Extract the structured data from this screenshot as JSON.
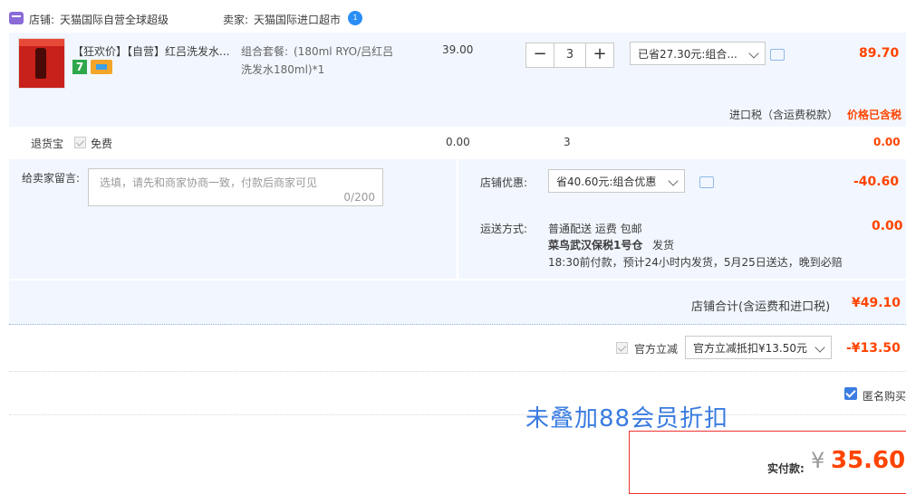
{
  "shop": {
    "label_shop": "店铺:",
    "shop_name": "天猫国际自营全球超级",
    "label_seller": "卖家:",
    "seller_name": "天猫国际进口超市",
    "badge_text": "1"
  },
  "item": {
    "title": "【狂欢价】【自营】红吕洗发水...",
    "tag_text": "7",
    "spec_label": "组合套餐:",
    "spec_value_line1": "(180ml RYO/吕红吕",
    "spec_value_line2": "洗发水180ml)*1",
    "unit_price": "39.00",
    "qty_minus": "−",
    "qty": "3",
    "qty_plus": "+",
    "discount_select": "已省27.30元:组合...",
    "subtotal": "89.70",
    "tax_label": "进口税（含运费税款）",
    "tax_value": "价格已含税"
  },
  "return_service": {
    "label": "退货宝",
    "option": "免费",
    "price": "0.00",
    "qty": "3",
    "subtotal": "0.00"
  },
  "message": {
    "label": "给卖家留言:",
    "placeholder": "选填，请先和商家协商一致，付款后商家可见",
    "counter": "0/200"
  },
  "store_discount": {
    "label": "店铺优惠:",
    "select": "省40.60元:组合优惠",
    "value": "-40.60"
  },
  "shipping": {
    "label": "运送方式:",
    "line1": "普通配送 运费 包邮",
    "line2_bold": "菜鸟武汉保税1号仓",
    "line2_rest": "发货",
    "line3": "18:30前付款，预计24小时内发货，5月25日送达，晚到必赔",
    "value": "0.00"
  },
  "store_total": {
    "label": "店铺合计(含运费和进口税)",
    "value": "¥49.10"
  },
  "official": {
    "label": "官方立减",
    "select": "官方立减抵扣¥13.50元",
    "value": "-¥13.50"
  },
  "anonymous": {
    "label": "匿名购买"
  },
  "overlay_note": "未叠加88会员折扣",
  "payment": {
    "label": "实付款:",
    "currency": "¥",
    "amount": "35.60"
  }
}
